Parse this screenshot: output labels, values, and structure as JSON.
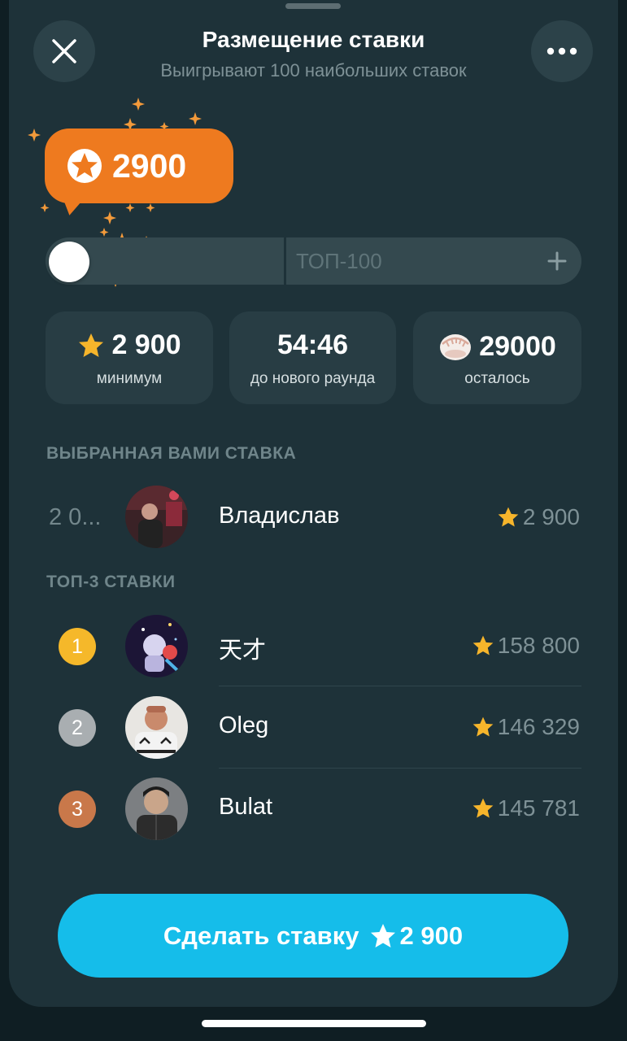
{
  "header": {
    "title": "Размещение ставки",
    "subtitle": "Выигрывают 100 наибольших ставок",
    "close_icon": "close-icon",
    "more_icon": "more-icon"
  },
  "bid_bubble": {
    "value": "2900",
    "icon": "star-icon",
    "color": "#ee7a1f"
  },
  "slider": {
    "position_fraction": 0.0,
    "right_label": "ТОП-100",
    "plus_icon": "plus-icon"
  },
  "stats": [
    {
      "value": "2 900",
      "label": "минимум",
      "icon": "star-icon"
    },
    {
      "value": "54:46",
      "label": "до нового раунда"
    },
    {
      "value": "29000",
      "label": "осталось",
      "icon": "dumpling-icon"
    }
  ],
  "my_bid": {
    "section_title": "ВЫБРАННАЯ ВАМИ СТАВКА",
    "rank": "2 0...",
    "name": "Владислав",
    "amount": "2 900"
  },
  "top3": {
    "section_title": "ТОП-3 СТАВКИ",
    "rows": [
      {
        "place": "1",
        "name": "天才",
        "amount": "158 800",
        "medal_color": "#f5b82a"
      },
      {
        "place": "2",
        "name": "Oleg",
        "amount": "146 329",
        "medal_color": "#a9aeb1"
      },
      {
        "place": "3",
        "name": "Bulat",
        "amount": "145 781",
        "medal_color": "#c9784a"
      }
    ]
  },
  "cta": {
    "label": "Сделать ставку",
    "amount": "2 900",
    "color": "#15bdea"
  }
}
